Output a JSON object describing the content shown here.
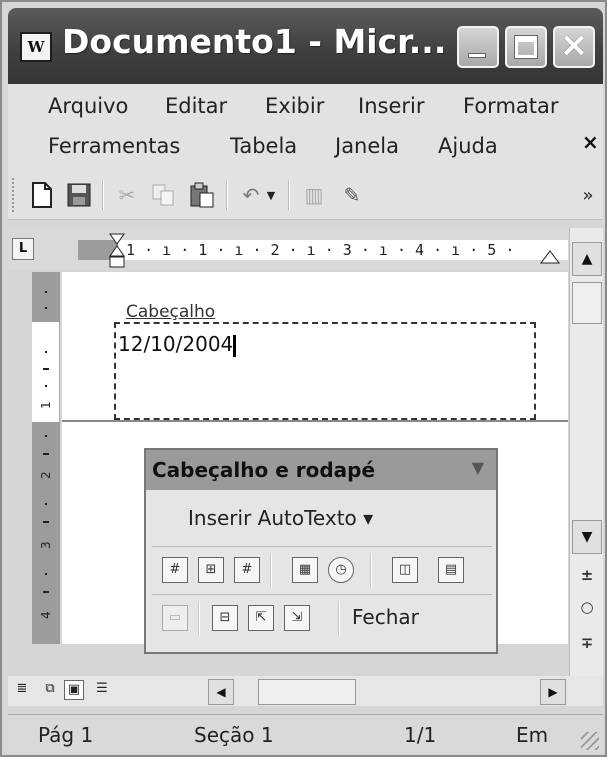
{
  "window": {
    "title": "Documento1 - Micr...",
    "app_icon_glyph": "W",
    "icons": [
      "word-app-icon",
      "minimize-icon",
      "maximize-icon",
      "close-icon"
    ]
  },
  "menu": {
    "items": [
      "Arquivo",
      "Editar",
      "Exibir",
      "Inserir",
      "Formatar",
      "Ferramentas",
      "Tabela",
      "Janela",
      "Ajuda"
    ],
    "close_glyph": "×"
  },
  "toolbar": {
    "icons": [
      "new-document-icon",
      "save-icon",
      "cut-icon",
      "copy-icon",
      "paste-icon",
      "undo-icon",
      "undo-dropdown-icon",
      "columns-icon",
      "drawing-icon",
      "toolbar-overflow-icon"
    ],
    "overflow_glyph": "»"
  },
  "ruler": {
    "tab_selector": "L",
    "text": "· 1 · ı · 1 · ı · 2 · ı · 3 · ı · 4 · ı · 5 ·"
  },
  "document": {
    "header_label": "Cabeçalho",
    "header_text": "12/10/2004"
  },
  "header_footer_toolbar": {
    "title": "Cabeçalho e rodapé",
    "title_menu_glyph": "▼",
    "insert_autotext": "Inserir AutoTexto ▾",
    "row1_icons": [
      "page-number-icon",
      "number-of-pages-icon",
      "format-page-number-icon",
      "insert-date-icon",
      "insert-time-icon",
      "page-setup-icon",
      "show-hide-text-icon"
    ],
    "row1_glyphs": [
      "#",
      "⊞",
      "#",
      "▦",
      "◷",
      "◫",
      "▤"
    ],
    "row2_icons": [
      "same-as-previous-icon",
      "switch-header-footer-icon",
      "show-previous-icon",
      "show-next-icon"
    ],
    "row2_glyphs": [
      "▭",
      "⊟",
      "⇱",
      "⇲"
    ],
    "close_label": "Fechar"
  },
  "scrollbar": {
    "up_glyph": "▲",
    "down_glyph": "▼",
    "prev_page_glyph": "±",
    "browse_object_glyph": "○",
    "next_page_glyph": "∓"
  },
  "view_buttons": {
    "glyphs": [
      "≣",
      "⧉",
      "▣",
      "☰"
    ],
    "left_glyph": "◀",
    "right_glyph": "▶"
  },
  "status": {
    "page": "Pág 1",
    "section": "Seção 1",
    "page_count": "1/1",
    "at": "Em"
  }
}
